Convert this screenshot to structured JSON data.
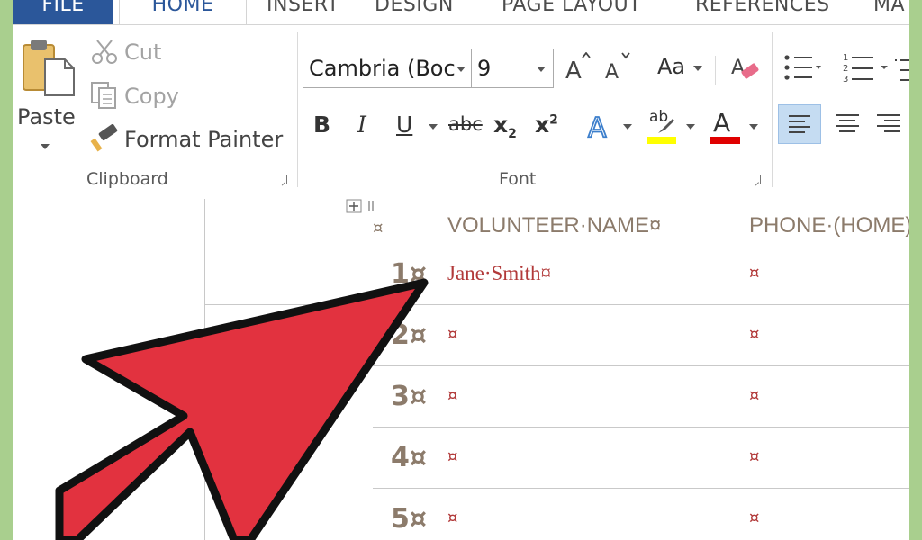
{
  "tabs": [
    {
      "label": "FILE"
    },
    {
      "label": "HOME"
    },
    {
      "label": "INSERT"
    },
    {
      "label": "DESIGN"
    },
    {
      "label": "PAGE LAYOUT"
    },
    {
      "label": "REFERENCES"
    },
    {
      "label": "MA"
    }
  ],
  "clipboard": {
    "paste_label": "Paste",
    "cut_label": "Cut",
    "copy_label": "Copy",
    "format_painter_label": "Format Painter",
    "group_label": "Clipboard"
  },
  "font": {
    "font_name": "Cambria (Boc",
    "font_size": "9",
    "change_case_label": "Aa",
    "bold_label": "B",
    "italic_label": "I",
    "underline_label": "U",
    "strike_label": "abc",
    "subscript_label": "x",
    "subscript_sub": "2",
    "superscript_label": "x",
    "superscript_sup": "2",
    "highlight_label": "ab",
    "font_color_label": "A",
    "group_label": "Font"
  },
  "table": {
    "col_name_header": "VOLUNTEER·NAME¤",
    "col_phone_header": "PHONE·(HOME)¤",
    "header_row_mark": "¤",
    "rows": [
      {
        "num": "1¤",
        "name": "Jane·Smith¤",
        "phone": "¤"
      },
      {
        "num": "2¤",
        "name": "¤",
        "phone": "¤"
      },
      {
        "num": "3¤",
        "name": "¤",
        "phone": "¤"
      },
      {
        "num": "4¤",
        "name": "¤",
        "phone": "¤"
      },
      {
        "num": "5¤",
        "name": "¤",
        "phone": "¤"
      }
    ]
  },
  "colors": {
    "file_tab": "#2b579a",
    "arrow_fill": "#e2323f",
    "highlight_yellow": "#ffff00",
    "font_color_red": "#e00000",
    "text_red": "#b23a3a",
    "background_green": "#a9cf8e"
  }
}
